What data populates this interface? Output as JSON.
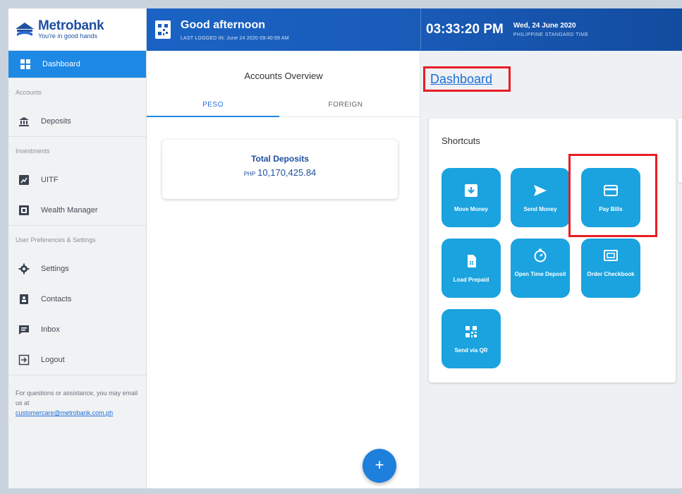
{
  "brand": {
    "name": "Metrobank",
    "tagline": "You're in good hands"
  },
  "sidebar": {
    "active": {
      "label": "Dashboard"
    },
    "sections": {
      "accounts": "Accounts",
      "investments": "Investments",
      "preferences": "User Preferences & Settings"
    },
    "items": {
      "deposits": "Deposits",
      "uitf": "UITF",
      "wealth": "Wealth Manager",
      "settings": "Settings",
      "contacts": "Contacts",
      "inbox": "Inbox",
      "logout": "Logout"
    },
    "assist_text": "For questions or assistance, you may email us at",
    "assist_email": "customercare@metrobank.com.ph"
  },
  "header": {
    "greeting": "Good afternoon",
    "last_logged": "LAST LOGGED IN: June 24 2020 09:40:59 AM",
    "time": "03:33:20 PM",
    "date": "Wed, 24 June 2020",
    "timezone": "PHILIPPINE STANDARD TIME"
  },
  "accounts": {
    "title": "Accounts Overview",
    "tabs": {
      "peso": "PESO",
      "foreign": "FOREIGN"
    },
    "deposit_card": {
      "title": "Total Deposits",
      "currency": "PHP",
      "amount": "10,170,425.84"
    },
    "fab": "+"
  },
  "dashboard": {
    "title": "Dashboard",
    "shortcuts_title": "Shortcuts",
    "tiles": {
      "move_money": "Move Money",
      "send_money": "Send Money",
      "pay_bills": "Pay Bills",
      "load_prepaid": "Load Prepaid",
      "open_time_deposit": "Open Time Deposit",
      "order_checkbook": "Order Checkbook",
      "send_via_qr": "Send via QR"
    }
  },
  "colors": {
    "primary": "#1e88e5",
    "brand_blue": "#1f4fa0",
    "tile": "#1aa3df",
    "highlight": "#ea1c24"
  }
}
